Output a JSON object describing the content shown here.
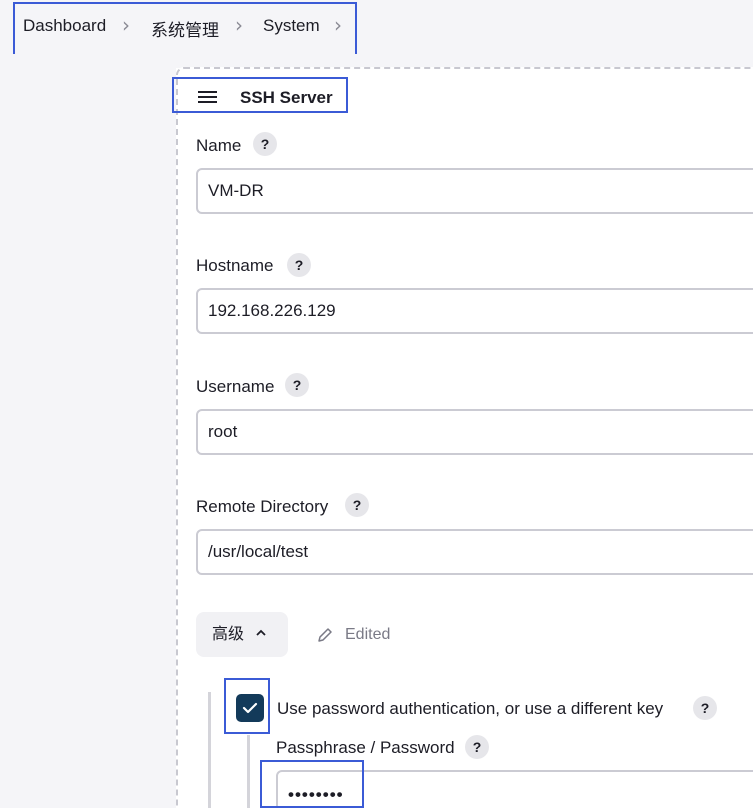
{
  "breadcrumb": {
    "items": [
      "Dashboard",
      "系统管理",
      "System"
    ]
  },
  "section": {
    "title": "SSH Server"
  },
  "fields": {
    "name": {
      "label": "Name",
      "value": "VM-DR"
    },
    "hostname": {
      "label": "Hostname",
      "value": "192.168.226.129"
    },
    "username": {
      "label": "Username",
      "value": "root"
    },
    "remote_dir": {
      "label": "Remote Directory",
      "value": "/usr/local/test"
    }
  },
  "advanced": {
    "label": "高级",
    "edited": "Edited"
  },
  "password_auth": {
    "checked": true,
    "label": "Use password authentication, or use a different key"
  },
  "passphrase": {
    "label": "Passphrase / Password",
    "value": "••••••••"
  },
  "help_glyph": "?",
  "colors": {
    "highlight": "#3b5bd6",
    "checkbox": "#133a5a"
  }
}
